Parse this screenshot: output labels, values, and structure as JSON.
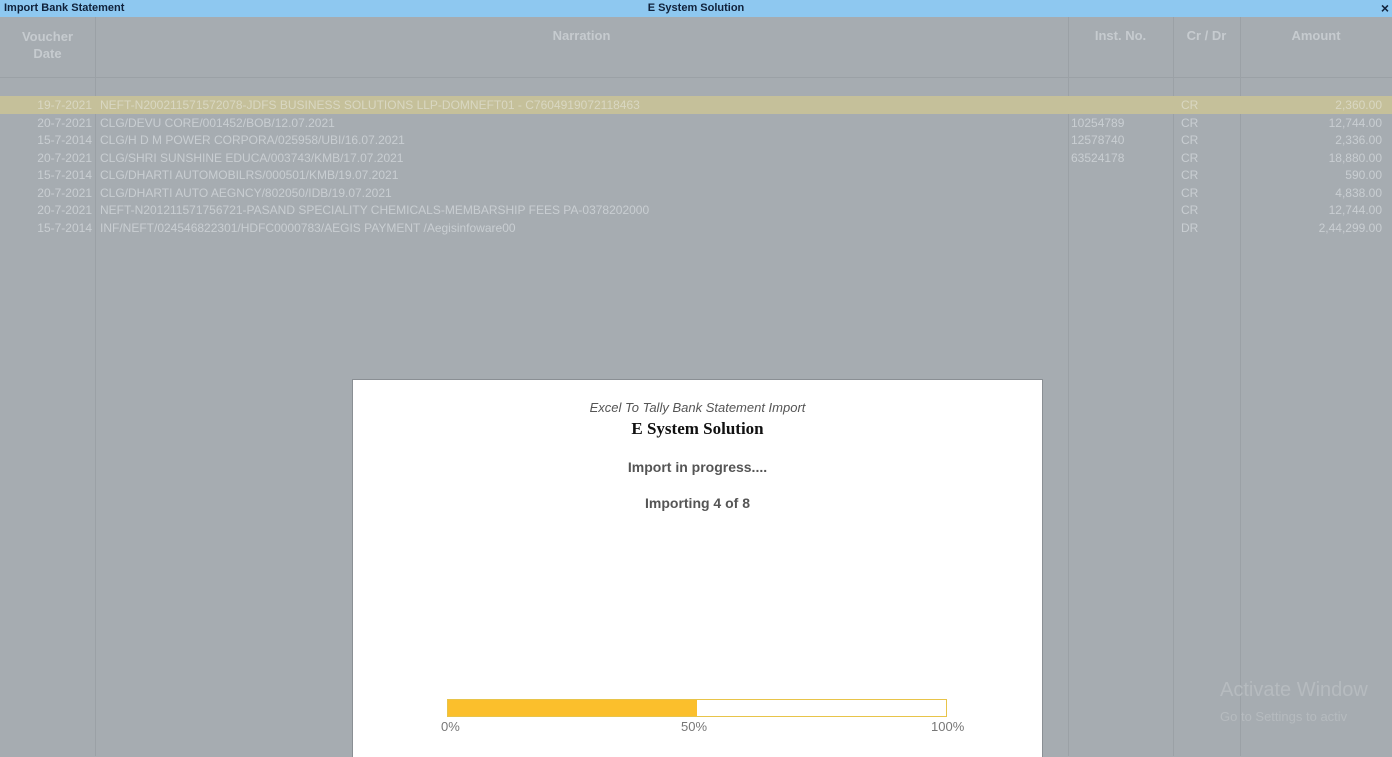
{
  "window": {
    "left_title": "Import Bank Statement",
    "center_title": "E System Solution",
    "close_label": "×"
  },
  "table": {
    "headers": {
      "date": "Voucher Date",
      "narration": "Narration",
      "inst": "Inst. No.",
      "crdr": "Cr / Dr",
      "amount": "Amount"
    },
    "rows": [
      {
        "date": "19-7-2021",
        "narration": "NEFT-N200211571572078-JDFS BUSINESS SOLUTIONS LLP-DOMNEFT01 - C7604919072118463",
        "inst": "",
        "crdr": "CR",
        "amount": "2,360.00"
      },
      {
        "date": "20-7-2021",
        "narration": "CLG/DEVU CORE/001452/BOB/12.07.2021",
        "inst": "10254789",
        "crdr": "CR",
        "amount": "12,744.00"
      },
      {
        "date": "15-7-2014",
        "narration": "CLG/H D M POWER CORPORA/025958/UBI/16.07.2021",
        "inst": "12578740",
        "crdr": "CR",
        "amount": "2,336.00"
      },
      {
        "date": "20-7-2021",
        "narration": "CLG/SHRI SUNSHINE EDUCA/003743/KMB/17.07.2021",
        "inst": "63524178",
        "crdr": "CR",
        "amount": "18,880.00"
      },
      {
        "date": "15-7-2014",
        "narration": "CLG/DHARTI AUTOMOBILRS/000501/KMB/19.07.2021",
        "inst": "",
        "crdr": "CR",
        "amount": "590.00"
      },
      {
        "date": "20-7-2021",
        "narration": "CLG/DHARTI AUTO AEGNCY/802050/IDB/19.07.2021",
        "inst": "",
        "crdr": "CR",
        "amount": "4,838.00"
      },
      {
        "date": "20-7-2021",
        "narration": "NEFT-N201211571756721-PASAND SPECIALITY CHEMICALS-MEMBARSHIP FEES PA-0378202000",
        "inst": "",
        "crdr": "CR",
        "amount": "12,744.00"
      },
      {
        "date": "15-7-2014",
        "narration": "INF/NEFT/024546822301/HDFC0000783/AEGIS PAYMENT /Aegisinfoware00",
        "inst": "",
        "crdr": "DR",
        "amount": "2,44,299.00"
      }
    ]
  },
  "dialog": {
    "subtitle": "Excel To Tally Bank Statement Import",
    "title": "E System Solution",
    "status": "Import in progress....",
    "count": "Importing 4 of 8",
    "progress_fraction": 0.5,
    "label_min": "0%",
    "label_mid": "50%",
    "label_max": "100%"
  },
  "watermark": {
    "line1": "Activate Window",
    "line2": "Go to Settings to activ"
  },
  "colors": {
    "titlebar": "#8ec8f0",
    "progress_fill": "#fbbf2c"
  }
}
